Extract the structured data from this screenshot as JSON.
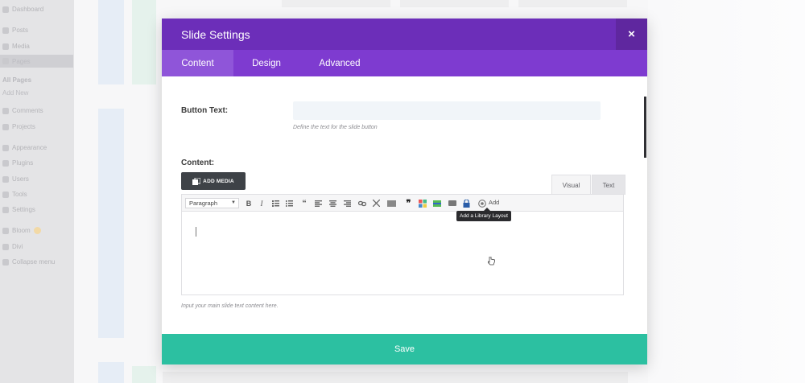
{
  "wp_sidebar": {
    "items": [
      {
        "label": "Dashboard",
        "icon": "dashboard-icon"
      },
      {
        "label": "Posts",
        "icon": "pin-icon"
      },
      {
        "label": "Media",
        "icon": "media-icon"
      },
      {
        "label": "Pages",
        "icon": "pages-icon"
      },
      {
        "label": "All Pages"
      },
      {
        "label": "Add New"
      },
      {
        "label": "Comments",
        "icon": "comment-icon"
      },
      {
        "label": "Projects",
        "icon": "pin-icon"
      },
      {
        "label": "Appearance",
        "icon": "brush-icon"
      },
      {
        "label": "Plugins",
        "icon": "plugin-icon"
      },
      {
        "label": "Users",
        "icon": "user-icon"
      },
      {
        "label": "Tools",
        "icon": "wrench-icon"
      },
      {
        "label": "Settings",
        "icon": "settings-icon"
      },
      {
        "label": "Bloom",
        "icon": "bloom-icon"
      },
      {
        "label": "Divi",
        "icon": "divi-icon"
      },
      {
        "label": "Collapse menu",
        "icon": "collapse-icon"
      }
    ]
  },
  "modal": {
    "title": "Slide Settings",
    "close_icon": "×",
    "tabs": [
      {
        "label": "Content",
        "active": true
      },
      {
        "label": "Design",
        "active": false
      },
      {
        "label": "Advanced",
        "active": false
      }
    ],
    "button_text": {
      "label": "Button Text:",
      "value": "",
      "description": "Define the text for the slide button"
    },
    "content": {
      "label": "Content:",
      "add_media_label": "ADD MEDIA",
      "editor_tabs": {
        "visual": "Visual",
        "text": "Text"
      },
      "format_select": "Paragraph",
      "toolbar_add_label": "Add",
      "tooltip": "Add a Library Layout",
      "description": "Input your main slide text content here."
    },
    "save_label": "Save"
  },
  "colors": {
    "header_purple": "#6c2eb9",
    "tabs_purple": "#7e3bd0",
    "save_green": "#2cc0a1"
  }
}
